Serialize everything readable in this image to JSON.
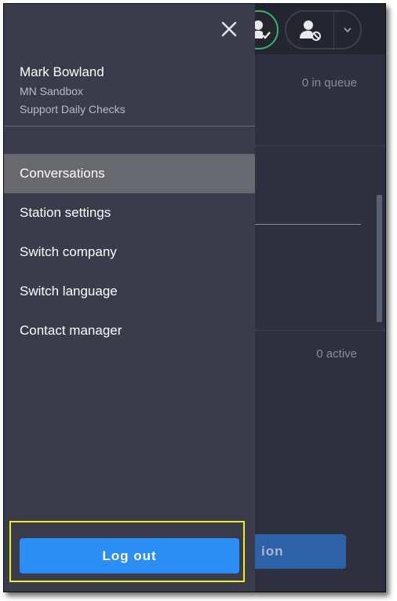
{
  "drawer": {
    "user_name": "Mark Bowland",
    "company": "MN Sandbox",
    "station": "Support Daily Checks",
    "close_icon": "close-icon",
    "menu": [
      {
        "label": "Conversations",
        "active": true
      },
      {
        "label": "Station settings",
        "active": false
      },
      {
        "label": "Switch company",
        "active": false
      },
      {
        "label": "Switch language",
        "active": false
      },
      {
        "label": "Contact manager",
        "active": false
      }
    ],
    "logout_label": "Log out"
  },
  "background": {
    "queue_status": "0 in queue",
    "active_status": "0 active",
    "partial_button_label": "ion",
    "status_icons": [
      "user-check-icon",
      "user-blocked-icon",
      "chevron-down-icon"
    ]
  },
  "colors": {
    "drawer_bg": "#3a3b4b",
    "active_item_bg": "#68696f",
    "primary_button": "#2b8ef5",
    "highlight_outline": "#ecec2a",
    "ready_status": "#3fae72"
  }
}
